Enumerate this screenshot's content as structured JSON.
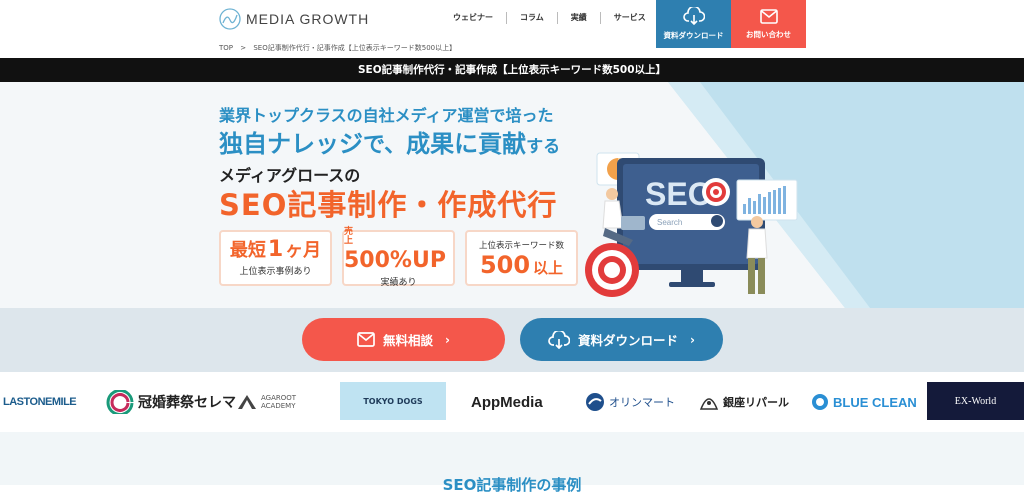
{
  "header": {
    "logo_text": "MEDIA GROWTH",
    "nav": [
      "ウェビナー",
      "コラム",
      "実績",
      "サービス"
    ],
    "download_label": "資料ダウンロード",
    "contact_label": "お問い合わせ",
    "breadcrumb_home": "TOP",
    "breadcrumb_sep": ">",
    "breadcrumb_current": "SEO記事制作代行・記事作成【上位表示キーワード数500以上】"
  },
  "title_bar": "SEO記事制作代行・記事作成【上位表示キーワード数500以上】",
  "hero": {
    "line1": "業界トップクラスの自社メディア運営で培った",
    "line2_em1": "独自ナレッジ",
    "line2_mid": "で、",
    "line2_em2": "成果に貢献",
    "line2_end": "する",
    "line3": "メディアグロースの",
    "line4": "SEO記事制作・作成代行",
    "badge1_prefix": "最短",
    "badge1_num": "1",
    "badge1_suffix": "ヶ月",
    "badge1_sub": "上位表示事例あり",
    "badge2_pre": "売上",
    "badge2_big": "500%UP",
    "badge2_sub": "実績あり",
    "badge3_top": "上位表示キーワード数",
    "badge3_num": "500",
    "badge3_suffix": "以上",
    "illustration_text": "SEO",
    "illustration_search": "Search"
  },
  "cta": {
    "free_label": "無料相談",
    "doc_label": "資料ダウンロード"
  },
  "client_logos": [
    "LASTONEMILE",
    "冠婚葬祭セレマ",
    "AGAROOT ACADEMY",
    "TOKYO DOGS",
    "AppMedia",
    "オリンマート",
    "銀座リパール",
    "BLUE CLEAN",
    "EX-World"
  ],
  "section_title": "SEO記事制作の事例",
  "colors": {
    "accent_blue": "#2b8fc4",
    "accent_orange": "#f2642b",
    "button_red": "#f4574b",
    "button_blue": "#2e7fb0"
  }
}
